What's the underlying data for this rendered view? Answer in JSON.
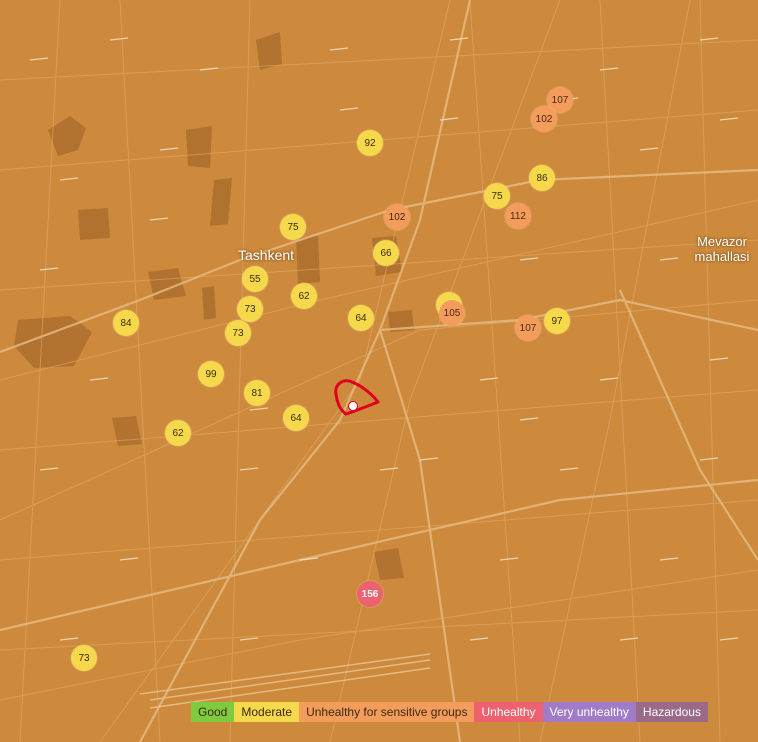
{
  "map": {
    "labels": {
      "city": "Tashkent",
      "district_line1": "Mevazor",
      "district_line2": "mahallasi"
    },
    "markers": [
      {
        "value": "107",
        "category": "usg"
      },
      {
        "value": "102",
        "category": "usg"
      },
      {
        "value": "92",
        "category": "moderate"
      },
      {
        "value": "86",
        "category": "moderate"
      },
      {
        "value": "75",
        "category": "moderate"
      },
      {
        "value": "112",
        "category": "usg"
      },
      {
        "value": "102",
        "category": "usg"
      },
      {
        "value": "75",
        "category": "moderate"
      },
      {
        "value": "66",
        "category": "moderate"
      },
      {
        "value": "55",
        "category": "moderate"
      },
      {
        "value": "62",
        "category": "moderate"
      },
      {
        "value": "73",
        "category": "moderate"
      },
      {
        "value": "84",
        "category": "moderate"
      },
      {
        "value": "73",
        "category": "moderate"
      },
      {
        "value": "64",
        "category": "moderate"
      },
      {
        "value": "105",
        "category": "usg"
      },
      {
        "value": "107",
        "category": "usg"
      },
      {
        "value": "97",
        "category": "moderate"
      },
      {
        "value": "99",
        "category": "moderate"
      },
      {
        "value": "81",
        "category": "moderate"
      },
      {
        "value": "64",
        "category": "moderate"
      },
      {
        "value": "62",
        "category": "moderate"
      },
      {
        "value": "156",
        "category": "unhealthy"
      },
      {
        "value": "73",
        "category": "moderate"
      }
    ]
  },
  "legend": {
    "good": {
      "label": "Good",
      "color": "#7ecb3f"
    },
    "moderate": {
      "label": "Moderate",
      "color": "#f6d94b"
    },
    "usg": {
      "label": "Unhealthy for sensitive groups",
      "color": "#f39c5c"
    },
    "unhealthy": {
      "label": "Unhealthy",
      "color": "#ee6270"
    },
    "very_unhealthy": {
      "label": "Very unhealthy",
      "color": "#a07bc8"
    },
    "hazardous": {
      "label": "Hazardous",
      "color": "#9b6a86"
    }
  },
  "colors": {
    "map_base": "#cd8a3c",
    "location_outline": "#e0001b"
  }
}
